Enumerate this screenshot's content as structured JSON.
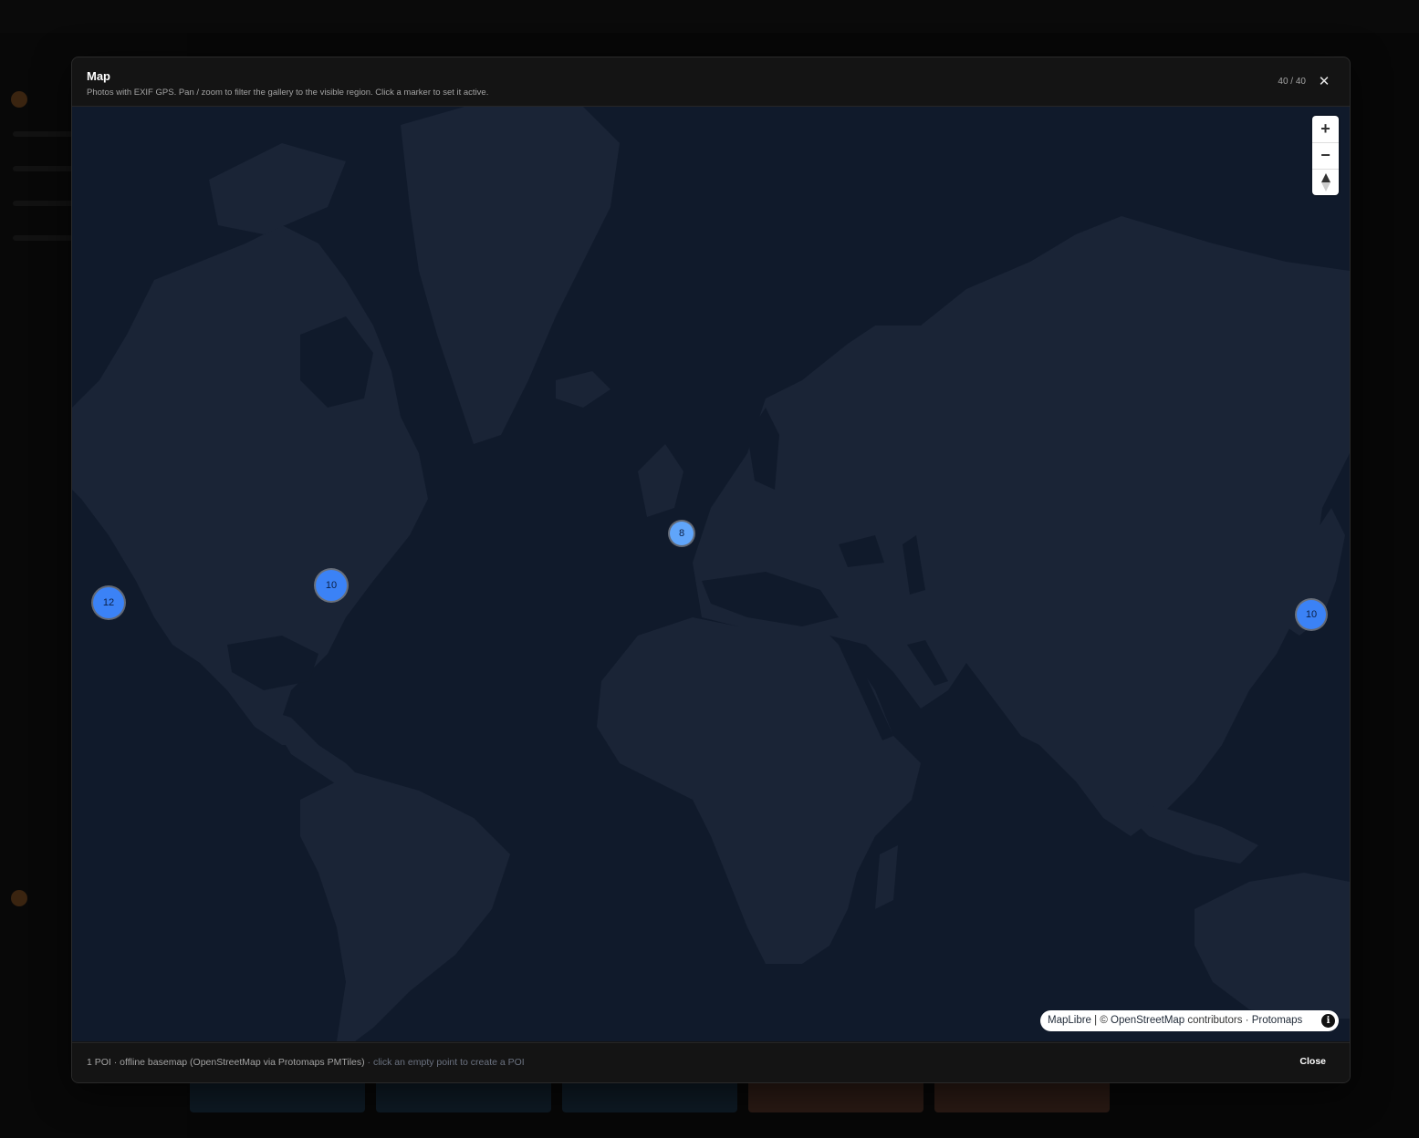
{
  "modal": {
    "title": "Map",
    "subtitle": "Photos with EXIF GPS. Pan / zoom to filter the gallery to the visible region. Click a marker to set it active.",
    "count": "40 / 40",
    "close_icon": "close-icon"
  },
  "map": {
    "zoom_in_icon": "plus-icon",
    "zoom_out_icon": "minus-icon",
    "compass_icon": "compass-icon",
    "markers": [
      {
        "count": "12"
      },
      {
        "count": "10"
      },
      {
        "count": "8"
      },
      {
        "count": "10"
      }
    ],
    "attribution": {
      "maplibre": "MapLibre",
      "sep1": " | © ",
      "osm": "OpenStreetMap",
      "contributors": " contributors",
      "sep2": " · ",
      "protomaps": "Protomaps",
      "info": "i"
    },
    "colors": {
      "water": "#101a2b",
      "land": "#1a2436",
      "marker": "#3b82f6",
      "marker_light": "#60a5fa"
    }
  },
  "footer": {
    "status": "1 POI · offline basemap (OpenStreetMap via Protomaps PMTiles)",
    "hint": " · click an empty point to create a POI",
    "close_label": "Close"
  }
}
